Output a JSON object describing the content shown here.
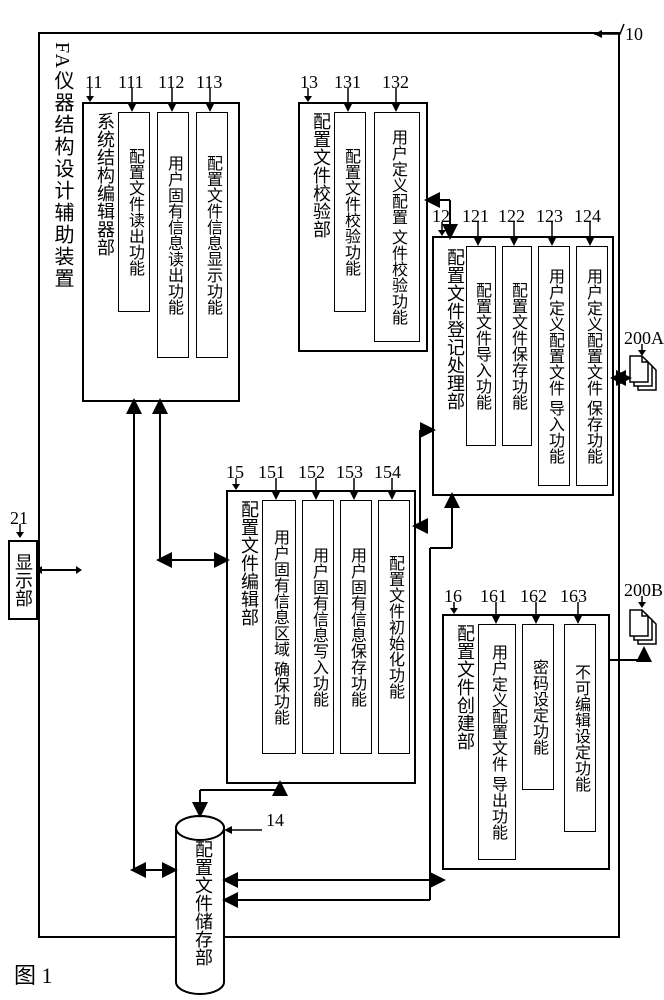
{
  "device_title": "FA仪器结构设计辅助装置",
  "display": {
    "label": "显示部",
    "ref": "21"
  },
  "figure_ref": "图 1",
  "outer_ref": "10",
  "modules": {
    "m11": {
      "ref": "11",
      "title": "系统结构编辑器部",
      "f111": {
        "ref": "111",
        "text": "配置文件读出功能"
      },
      "f112": {
        "ref": "112",
        "text": "用户固有信息读出功能"
      },
      "f113": {
        "ref": "113",
        "text": "配置文件信息显示功能"
      }
    },
    "m13": {
      "ref": "13",
      "title": "配置文件校验部",
      "f131": {
        "ref": "131",
        "text": "配置文件校验功能"
      },
      "f132": {
        "ref": "132",
        "text": "用户定义配置\n文件校验功能"
      }
    },
    "m12": {
      "ref": "12",
      "title": "配置文件登记处理部",
      "f121": {
        "ref": "121",
        "text": "配置文件导入功能"
      },
      "f122": {
        "ref": "122",
        "text": "配置文件保存功能"
      },
      "f123": {
        "ref": "123",
        "text": "用户定义配置文件\n导入功能"
      },
      "f124": {
        "ref": "124",
        "text": "用户定义配置文件\n保存功能"
      }
    },
    "m15": {
      "ref": "15",
      "title": "配置文件编辑部",
      "f151": {
        "ref": "151",
        "text": "用户固有信息区域\n确保功能"
      },
      "f152": {
        "ref": "152",
        "text": "用户固有信息写入功能"
      },
      "f153": {
        "ref": "153",
        "text": "用户固有信息保存功能"
      },
      "f154": {
        "ref": "154",
        "text": "配置文件初始化功能"
      }
    },
    "m16": {
      "ref": "16",
      "title": "配置文件创建部",
      "f161": {
        "ref": "161",
        "text": "用户定义配置文件\n导出功能"
      },
      "f162": {
        "ref": "162",
        "text": "密码设定功能"
      },
      "f163": {
        "ref": "163",
        "text": "不可编辑设定功能"
      }
    }
  },
  "storage": {
    "ref": "14",
    "text": "配置文件储存部"
  },
  "external": {
    "a": "200A",
    "b": "200B"
  }
}
